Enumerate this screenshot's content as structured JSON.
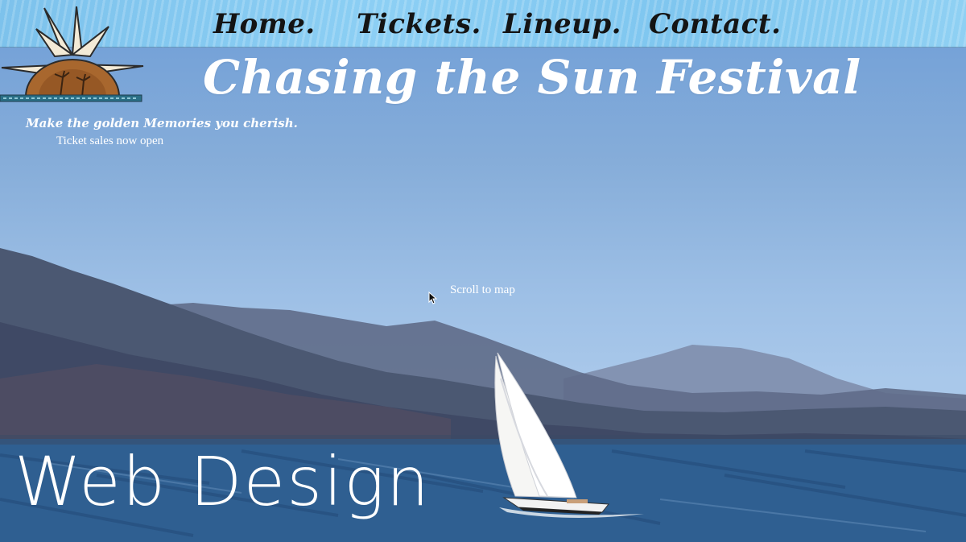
{
  "nav": {
    "items": [
      {
        "label": "Home."
      },
      {
        "label": "Tickets."
      },
      {
        "label": "Lineup."
      },
      {
        "label": "Contact."
      }
    ]
  },
  "hero": {
    "title": "Chasing the Sun Festival",
    "tagline": "Make the golden Memories you cherish.",
    "ticket_note": "Ticket sales now open",
    "scroll_link": "Scroll to map"
  },
  "watermark": {
    "text": "Web Design"
  },
  "colors": {
    "sky_top": "#6f9ed8",
    "nav_strip": "#8ccff4",
    "mountains_dark": "#4b5872",
    "sea": "#2f5f91",
    "logo_sun": "#a8672e"
  },
  "icons": {
    "logo": "sunburst-logo-icon",
    "cursor": "pointer-cursor-icon",
    "boat": "sailboat-icon"
  }
}
